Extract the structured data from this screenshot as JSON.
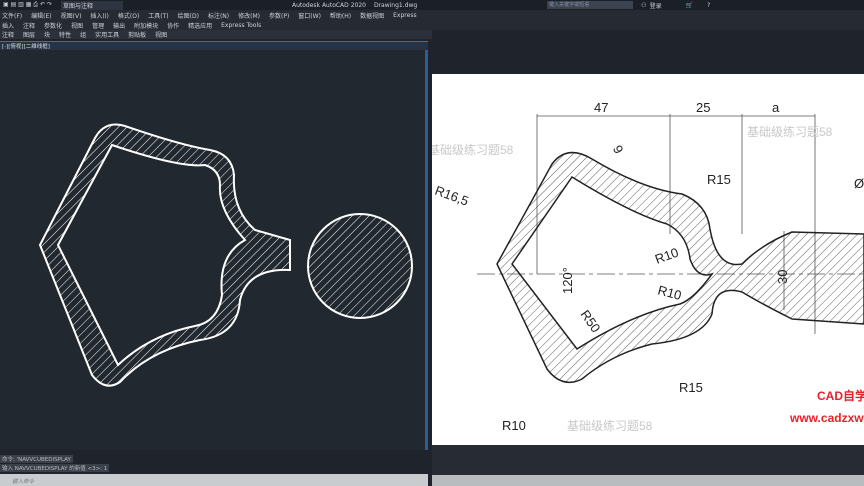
{
  "title_bar": {
    "workspace": "草图与注释",
    "app_title": "Autodesk AutoCAD 2020",
    "file": "Drawing1.dwg",
    "search_placeholder": "键入关键字或短语",
    "login": "登录"
  },
  "menu": [
    "文件(F)",
    "编辑(E)",
    "视图(V)",
    "插入(I)",
    "格式(O)",
    "工具(T)",
    "绘图(D)",
    "标注(N)",
    "修改(M)",
    "参数(P)",
    "窗口(W)",
    "帮助(H)",
    "数据视图",
    "Express"
  ],
  "ribbon_tabs": [
    "插入",
    "注释",
    "参数化",
    "视图",
    "管理",
    "输出",
    "附加模块",
    "协作",
    "精选应用",
    "Express Tools"
  ],
  "panels": [
    "注释",
    "图层",
    "块",
    "特性",
    "组",
    "实用工具",
    "剪贴板",
    "视图"
  ],
  "viewport_label": "[-][俯视][二维线框]",
  "command_history": [
    "命令: 'NAVVCUBEDISPLAY",
    "输入 NAVVCUBEDISPLAY 的新值 <3>: 1"
  ],
  "command_placeholder": "键入命令",
  "reference": {
    "dims": [
      "47",
      "25",
      "a",
      "R15",
      "9",
      "R16,5",
      "R10",
      "120°",
      "30",
      "R50",
      "R10",
      "R15",
      "R10",
      "Ø"
    ],
    "watermark": "基础级练习题58",
    "brand": "CAD自学网",
    "url": "www.cadzxw.com",
    "brand_color": "#e8202a"
  }
}
